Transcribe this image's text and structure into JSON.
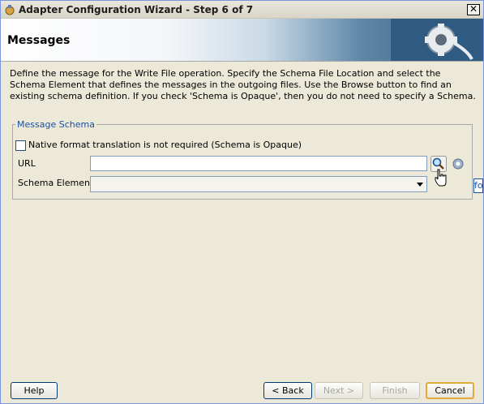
{
  "window": {
    "title": "Adapter Configuration Wizard - Step 6 of 7",
    "close_label": "✕"
  },
  "header": {
    "title": "Messages"
  },
  "description": "Define the message for the Write File operation.  Specify the Schema File Location and select the Schema Element that defines the messages in the outgoing files. Use the Browse button to find an existing schema definition. If you check 'Schema is Opaque', then you do not need to specify a Schema.",
  "message_schema": {
    "legend": "Message Schema",
    "opaque_checkbox": {
      "label": "Native format translation is not required (Schema is Opaque)",
      "checked": false
    },
    "url": {
      "label": "URL",
      "value": ""
    },
    "schema_element": {
      "label": "Schema Element",
      "selected": ""
    },
    "side_tab": "fo"
  },
  "buttons": {
    "help": "Help",
    "back": "< Back",
    "next": "Next >",
    "finish": "Finish",
    "cancel": "Cancel"
  },
  "icons": {
    "title": "wizard-icon",
    "header": "adapter-plug-gear-icon",
    "browse": "search-magnifier-icon",
    "options": "gear-icon",
    "cursor": "hand-cursor-icon"
  }
}
